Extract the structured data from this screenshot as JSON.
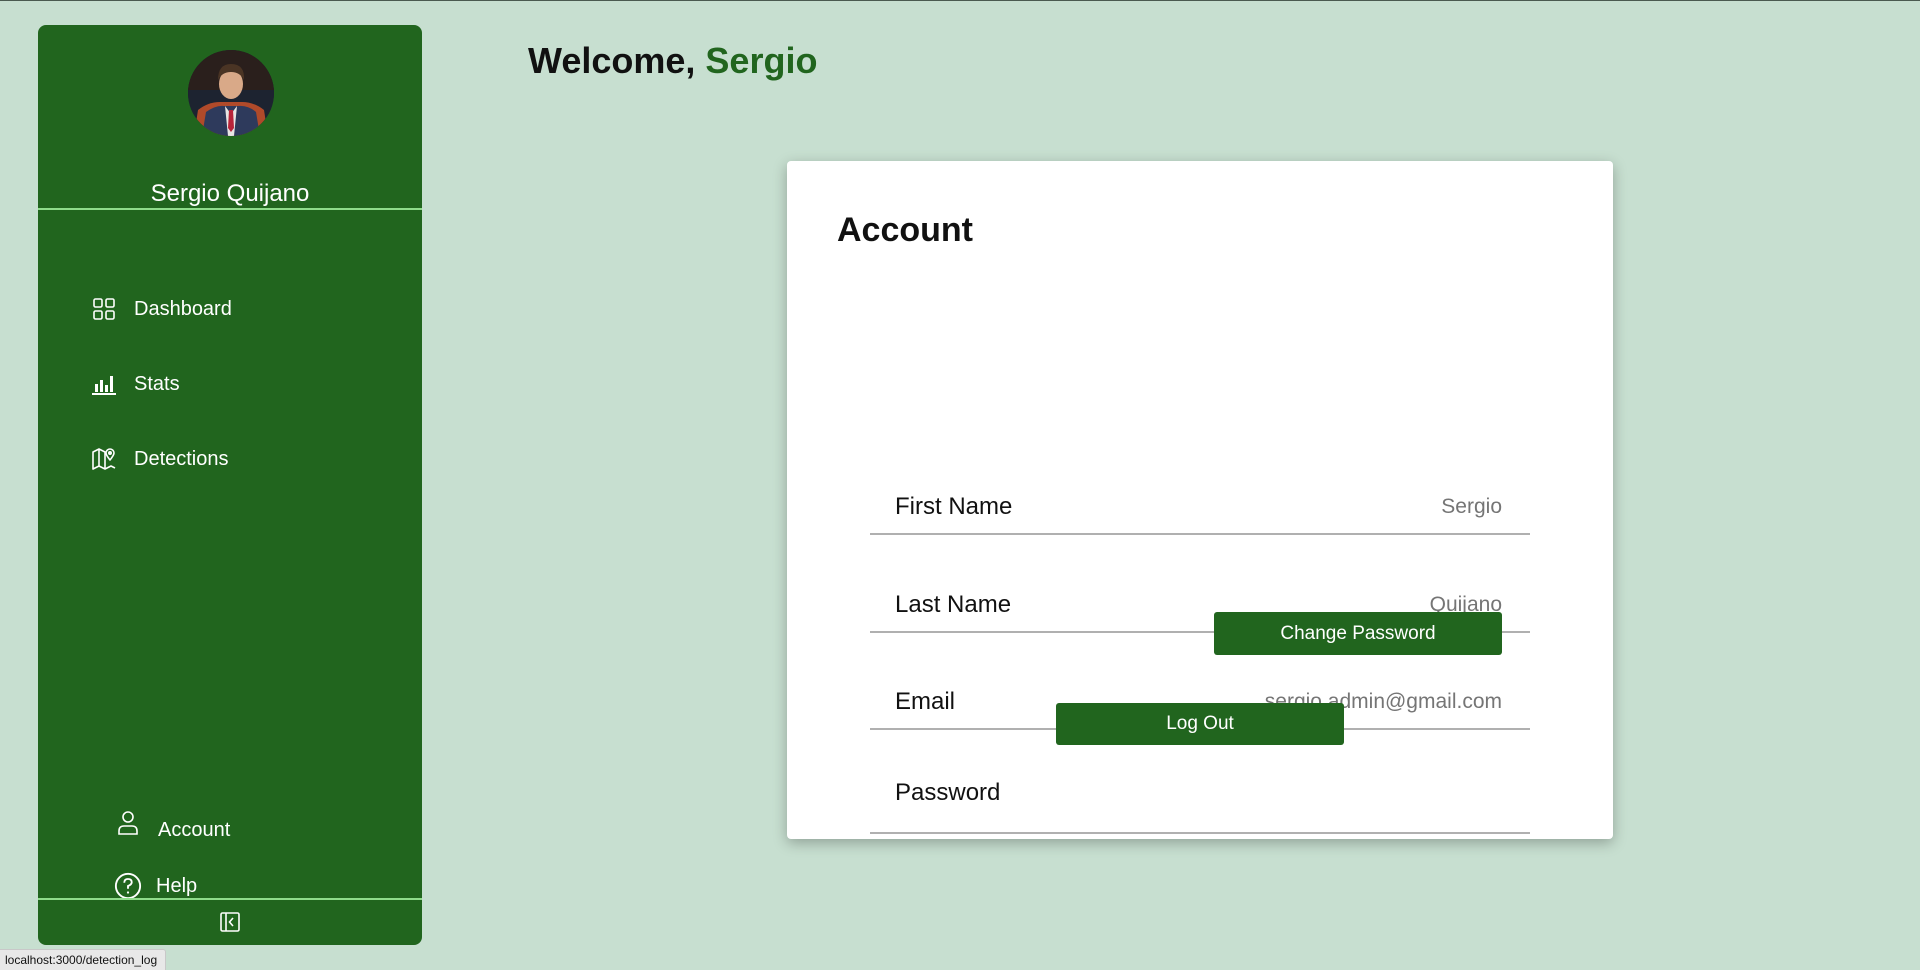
{
  "sidebar": {
    "profile_name": "Sergio Quijano",
    "nav": [
      {
        "label": "Dashboard",
        "icon": "grid-icon"
      },
      {
        "label": "Stats",
        "icon": "bar-chart-icon"
      },
      {
        "label": "Detections",
        "icon": "map-pin-icon"
      }
    ],
    "bottom": [
      {
        "label": "Account",
        "icon": "user-icon"
      },
      {
        "label": "Help",
        "icon": "help-circle-icon"
      }
    ],
    "collapse_icon": "collapse-sidebar-icon"
  },
  "header": {
    "welcome_prefix": "Welcome, ",
    "welcome_name": "Sergio"
  },
  "account": {
    "title": "Account",
    "first_name": {
      "label": "First Name",
      "placeholder": "Sergio"
    },
    "last_name": {
      "label": "Last Name",
      "placeholder": "Quijano"
    },
    "email": {
      "label": "Email",
      "placeholder": "sergio.admin@gmail.com"
    },
    "password": {
      "label": "Password",
      "button": "Change Password"
    },
    "logout": "Log Out"
  },
  "status_bar": {
    "url": "localhost:3000/detection_log"
  },
  "colors": {
    "background": "#c7dfd0",
    "sidebar": "#21651e",
    "accent": "#21651e",
    "divider": "#8fdc8b"
  }
}
